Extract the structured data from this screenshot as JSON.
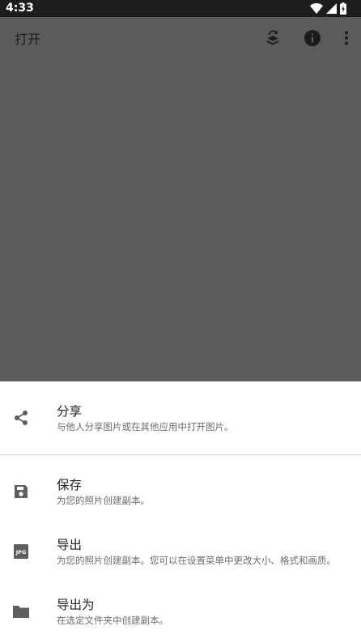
{
  "status_bar": {
    "time": "4:33"
  },
  "app_bar": {
    "title": "打开",
    "actions": [
      "layers-history-icon",
      "info-icon",
      "more-vert-icon"
    ]
  },
  "bottom_sheet": {
    "items": [
      {
        "icon": "share-icon",
        "title": "分享",
        "subtitle": "与他人分享图片或在其他应用中打开图片。"
      },
      {
        "icon": "save-icon",
        "title": "保存",
        "subtitle": "为您的照片创建副本。"
      },
      {
        "icon": "jpg-file-icon",
        "icon_text": "JPG",
        "title": "导出",
        "subtitle": "为您的照片创建副本。您可以在设置菜单中更改大小、格式和画质。"
      },
      {
        "icon": "folder-icon",
        "title": "导出为",
        "subtitle": "在选定文件夹中创建副本。"
      }
    ]
  },
  "colors": {
    "status_bar": "#1d1d1d",
    "scrim": "#5b5b5b",
    "sheet_background": "#ffffff",
    "icon": "#5f5f5f",
    "divider": "#d8d8d8"
  }
}
